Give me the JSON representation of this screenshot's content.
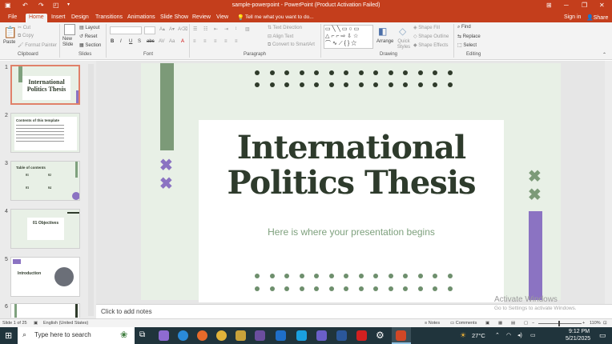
{
  "titlebar": {
    "title": "sample-powerpoint - PowerPoint (Product Activation Failed)"
  },
  "tabs": [
    "File",
    "Home",
    "Insert",
    "Design",
    "Transitions",
    "Animations",
    "Slide Show",
    "Review",
    "View"
  ],
  "tell_me": "Tell me what you want to do...",
  "sign_in": "Sign in",
  "share": "Share",
  "ribbon": {
    "paste": "Paste",
    "cut": "Cut",
    "copy": "Copy",
    "format_painter": "Format Painter",
    "new_slide": "New Slide",
    "layout": "Layout",
    "reset": "Reset",
    "section": "Section",
    "text_direction": "Text Direction",
    "align_text": "Align Text",
    "convert_smartart": "Convert to SmartArt",
    "arrange": "Arrange",
    "quick_styles": "Quick Styles",
    "shape_fill": "Shape Fill",
    "shape_outline": "Shape Outline",
    "shape_effects": "Shape Effects",
    "find": "Find",
    "replace": "Replace",
    "select": "Select",
    "groups": {
      "clipboard": "Clipboard",
      "slides": "Slides",
      "font": "Font",
      "paragraph": "Paragraph",
      "drawing": "Drawing",
      "editing": "Editing"
    }
  },
  "slides": [
    {
      "num": "1",
      "title": "International Politics Thesis"
    },
    {
      "num": "2",
      "title": "Contents of this template"
    },
    {
      "num": "3",
      "title": "Table of contents"
    },
    {
      "num": "4",
      "title": "01 Objectives"
    },
    {
      "num": "5",
      "title": "Introduction"
    },
    {
      "num": "6",
      "title": ""
    }
  ],
  "thumb3_items": [
    "01",
    "02",
    "03",
    "04"
  ],
  "slide": {
    "title_line1": "International",
    "title_line2": "Politics Thesis",
    "subtitle": "Here is where your presentation begins",
    "colors": {
      "dark_green": "#2e3b2c",
      "sage": "#7fa17e",
      "purple": "#8b73c2",
      "bg": "#e8f0e6"
    }
  },
  "notes_placeholder": "Click to add notes",
  "watermark": {
    "line1": "Activate Windows",
    "line2": "Go to Settings to activate Windows."
  },
  "status": {
    "slide_of": "Slide 1 of 25",
    "language": "English (United States)",
    "notes": "Notes",
    "comments": "Comments",
    "zoom": "110%"
  },
  "taskbar": {
    "search": "Type here to search",
    "temp": "27°C",
    "time": "9:12 PM",
    "date": "5/21/2025"
  }
}
